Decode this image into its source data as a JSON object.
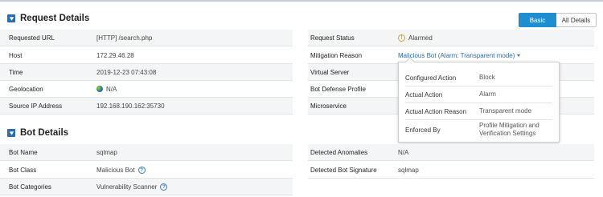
{
  "request_details": {
    "title": "Request Details",
    "view_buttons": {
      "basic": "Basic",
      "all": "All Details"
    },
    "left_rows": [
      {
        "label": "Requested URL",
        "value": "[HTTP] /search.php"
      },
      {
        "label": "Host",
        "value": "172.29.46.28"
      },
      {
        "label": "Time",
        "value": "2019-12-23 07:43:08"
      },
      {
        "label": "Geolocation",
        "value": "N/A"
      },
      {
        "label": "Source IP Address",
        "value": "192.168.190.162:35730"
      }
    ],
    "right_rows": [
      {
        "label": "Request Status",
        "value": "Alarmed"
      },
      {
        "label": "Mitigation Reason",
        "value": "Malicious Bot (Alarm: Transparent mode)"
      },
      {
        "label": "Virtual Server",
        "value": ""
      },
      {
        "label": "Bot Defense Profile",
        "value": ""
      },
      {
        "label": "Microservice",
        "value": ""
      }
    ],
    "popover": [
      {
        "label": "Configured Action",
        "value": "Block"
      },
      {
        "label": "Actual Action",
        "value": "Alarm"
      },
      {
        "label": "Actual Action Reason",
        "value": "Transparent mode"
      },
      {
        "label": "Enforced By",
        "value": "Profile Mitigation and Verification Settings"
      }
    ]
  },
  "bot_details": {
    "title": "Bot Details",
    "left_rows": [
      {
        "label": "Bot Name",
        "value": "sqlmap"
      },
      {
        "label": "Bot Class",
        "value": "Malicious Bot"
      },
      {
        "label": "Bot Categories",
        "value": "Vulnerability Scanner"
      }
    ],
    "right_rows": [
      {
        "label": "Detected Anomalies",
        "value": "N/A"
      },
      {
        "label": "Detected Bot Signature",
        "value": "sqlmap"
      }
    ]
  },
  "icons": {
    "collapse": "triangle-down-icon",
    "help": "question-circle-icon",
    "geo": "globe-icon",
    "status": "warning-circle-icon",
    "dropdown": "caret-down-icon"
  },
  "colors": {
    "accent": "#1f8ed1",
    "link": "#2a6db3",
    "warning": "#e0a020"
  }
}
